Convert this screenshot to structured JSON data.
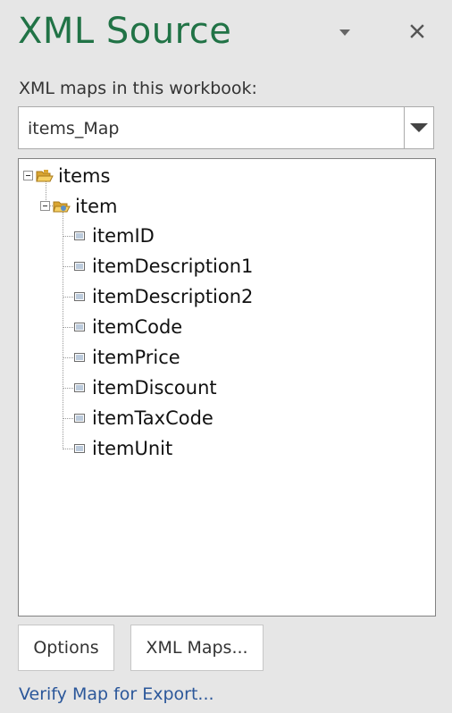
{
  "pane": {
    "title": "XML Source",
    "menu_icon": "chevron-down-icon",
    "close_icon": "close-icon"
  },
  "maps": {
    "label": "XML maps in this workbook:",
    "selected": "items_Map"
  },
  "tree": {
    "root": {
      "label": "items",
      "icon": "folder-icon",
      "expanded": true
    },
    "child": {
      "label": "item",
      "icon": "folder-icon",
      "expanded": true
    },
    "elements": [
      {
        "label": "itemID"
      },
      {
        "label": "itemDescription1"
      },
      {
        "label": "itemDescription2"
      },
      {
        "label": "itemCode"
      },
      {
        "label": "itemPrice"
      },
      {
        "label": "itemDiscount"
      },
      {
        "label": "itemTaxCode"
      },
      {
        "label": "itemUnit"
      }
    ]
  },
  "buttons": {
    "options": "Options",
    "xml_maps": "XML Maps..."
  },
  "link": {
    "verify": "Verify Map for Export..."
  },
  "colors": {
    "title": "#217346",
    "link": "#2b579a",
    "background": "#e6e6e6"
  }
}
